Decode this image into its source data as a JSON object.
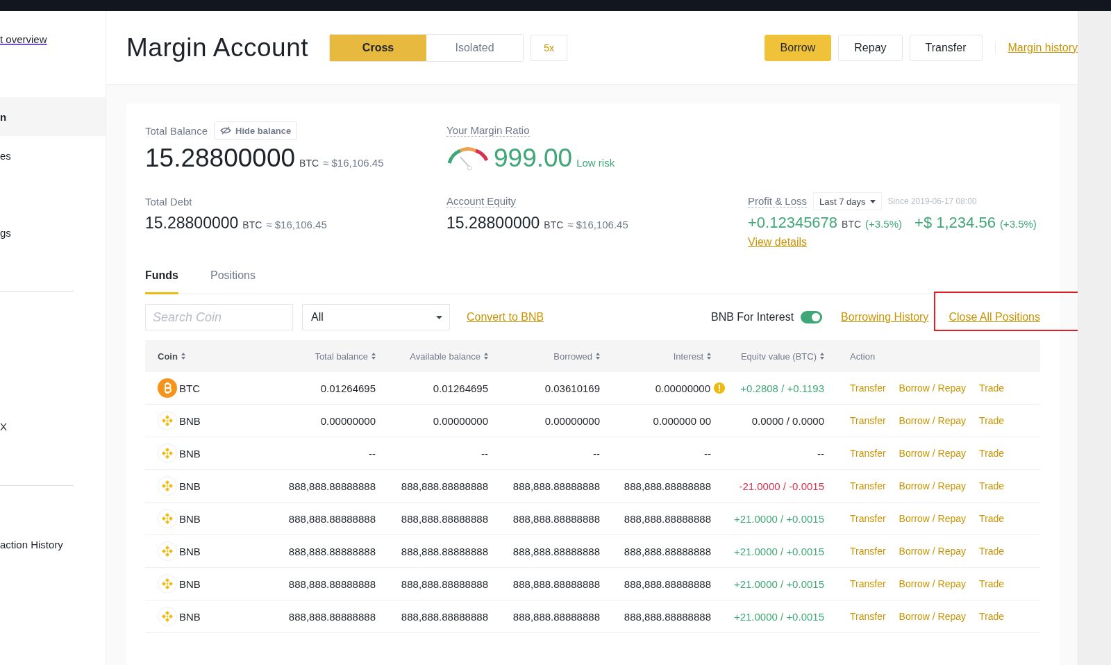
{
  "sidebar": {
    "items": [
      {
        "label": "t overview",
        "kind": "link",
        "selected": false
      },
      {
        "label": "n",
        "kind": "item",
        "selected": true
      },
      {
        "label": "es",
        "kind": "item",
        "selected": false
      },
      {
        "label": "gs",
        "kind": "item",
        "selected": false
      },
      {
        "label": "X",
        "kind": "item",
        "selected": false
      },
      {
        "label": "action History",
        "kind": "item",
        "selected": false
      }
    ]
  },
  "header": {
    "title": "Margin Account",
    "mode_tabs": [
      {
        "label": "Cross",
        "selected": true
      },
      {
        "label": "Isolated",
        "selected": false
      }
    ],
    "leverage": "5x",
    "buttons": [
      {
        "label": "Borrow",
        "kind": "primary"
      },
      {
        "label": "Repay",
        "kind": "default"
      },
      {
        "label": "Transfer",
        "kind": "default"
      }
    ],
    "history_link": "Margin history"
  },
  "summary": {
    "total_balance": {
      "label": "Total Balance",
      "hide_button": "Hide balance",
      "value": "15.28800000",
      "unit": "BTC",
      "approx": "≈ $16,106.45"
    },
    "margin_ratio": {
      "label": "Your Margin Ratio",
      "value": "999.00",
      "risk": "Low risk"
    },
    "total_debt": {
      "label": "Total Debt",
      "value": "15.28800000",
      "unit": "BTC",
      "approx": "≈ $16,106.45"
    },
    "account_equity": {
      "label": "Account Equity",
      "value": "15.28800000",
      "unit": "BTC",
      "approx": "≈ $16,106.45"
    },
    "profit_loss": {
      "label": "Profit & Loss",
      "period": "Last 7 days",
      "since": "Since 2019-06-17 08:00",
      "btc_value": "+0.12345678",
      "btc_unit": "BTC",
      "btc_pct": "(+3.5%)",
      "usd_value": "+$ 1,234.56",
      "usd_pct": "(+3.5%)",
      "details_link": "View details"
    }
  },
  "tabs": [
    {
      "label": "Funds",
      "selected": true
    },
    {
      "label": "Positions",
      "selected": false
    }
  ],
  "toolbar": {
    "search": {
      "placeholder": "Search Coin"
    },
    "filter": "All",
    "convert_link": "Convert to BNB",
    "bnb_interest": {
      "label": "BNB For Interest",
      "on": true
    },
    "borrowing_history": "Borrowing History",
    "close_all": "Close All Positions",
    "close_all_highlighted": true
  },
  "table": {
    "columns": [
      "Coin",
      "Total balance",
      "Available balance",
      "Borrowed",
      "Interest",
      "Equitv value (BTC)",
      "Action"
    ],
    "rows": [
      {
        "coin": "BTC",
        "kind": "btc",
        "total": "0.01264695",
        "available": "0.01264695",
        "borrowed": "0.03610169",
        "interest": "0.00000000",
        "warning": true,
        "equity": "+0.2808 / +0.1193",
        "color": "#3fa777",
        "actions": [
          "Transfer",
          "Borrow / Repay",
          "Trade"
        ]
      },
      {
        "coin": "BNB",
        "kind": "bnb",
        "total": "0.00000000",
        "available": "0.00000000",
        "borrowed": "0.00000000",
        "interest": "0.000000 00",
        "warning": false,
        "equity": "0.0000 / 0.0000",
        "color": "#1e2329",
        "actions": [
          "Transfer",
          "Borrow / Repay",
          "Trade"
        ]
      },
      {
        "coin": "BNB",
        "kind": "bnb",
        "total": "--",
        "available": "--",
        "borrowed": "--",
        "interest": "--",
        "warning": false,
        "equity": "--",
        "color": "#1e2329",
        "actions": [
          "Transfer",
          "Borrow / Repay",
          "Trade"
        ]
      },
      {
        "coin": "BNB",
        "kind": "bnb",
        "total": "888,888.88888888",
        "available": "888,888.88888888",
        "borrowed": "888,888.88888888",
        "interest": "888,888.88888888",
        "warning": false,
        "equity": "-21.0000 / -0.0015",
        "color": "#d9304e",
        "actions": [
          "Transfer",
          "Borrow / Repay",
          "Trade"
        ]
      },
      {
        "coin": "BNB",
        "kind": "bnb",
        "total": "888,888.88888888",
        "available": "888,888.88888888",
        "borrowed": "888,888.88888888",
        "interest": "888,888.88888888",
        "warning": false,
        "equity": "+21.0000 / +0.0015",
        "color": "#3fa777",
        "actions": [
          "Transfer",
          "Borrow / Repay",
          "Trade"
        ]
      },
      {
        "coin": "BNB",
        "kind": "bnb",
        "total": "888,888.88888888",
        "available": "888,888.88888888",
        "borrowed": "888,888.88888888",
        "interest": "888,888.88888888",
        "warning": false,
        "equity": "+21.0000 / +0.0015",
        "color": "#3fa777",
        "actions": [
          "Transfer",
          "Borrow / Repay",
          "Trade"
        ]
      },
      {
        "coin": "BNB",
        "kind": "bnb",
        "total": "888,888.88888888",
        "available": "888,888.88888888",
        "borrowed": "888,888.88888888",
        "interest": "888,888.88888888",
        "warning": false,
        "equity": "+21.0000 / +0.0015",
        "color": "#3fa777",
        "actions": [
          "Transfer",
          "Borrow / Repay",
          "Trade"
        ]
      },
      {
        "coin": "BNB",
        "kind": "bnb",
        "total": "888,888.88888888",
        "available": "888,888.88888888",
        "borrowed": "888,888.88888888",
        "interest": "888,888.88888888",
        "warning": false,
        "equity": "+21.0000 / +0.0015",
        "color": "#3fa777",
        "actions": [
          "Transfer",
          "Borrow / Repay",
          "Trade"
        ]
      }
    ]
  }
}
